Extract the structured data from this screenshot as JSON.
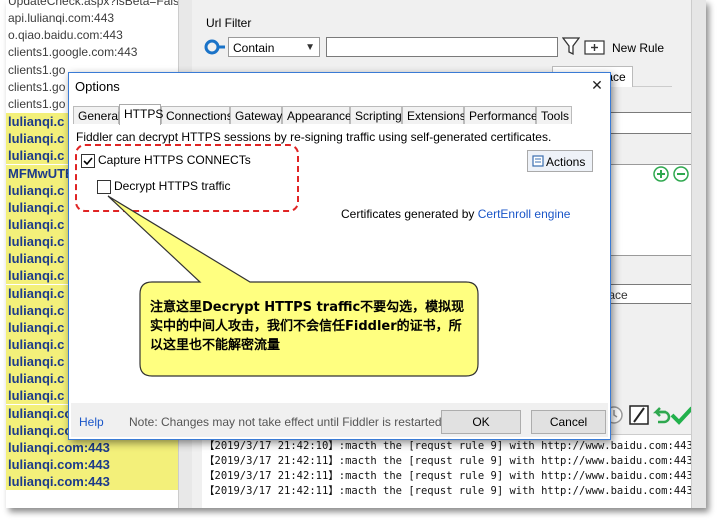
{
  "session_list": {
    "rows": [
      {
        "text": "UpdateCheck.aspx?isBeta=False",
        "highlight": false
      },
      {
        "text": "api.lulianqi.com:443",
        "highlight": false
      },
      {
        "text": "o.qiao.baidu.com:443",
        "highlight": false
      },
      {
        "text": "clients1.google.com:443",
        "highlight": false
      },
      {
        "text": "clients1.go",
        "highlight": false
      },
      {
        "text": "clients1.go",
        "highlight": false
      },
      {
        "text": "clients1.go",
        "highlight": false
      },
      {
        "text": "lulianqi.c",
        "highlight": true
      },
      {
        "text": "lulianqi.c",
        "highlight": true
      },
      {
        "text": "lulianqi.c",
        "highlight": true
      },
      {
        "text": "MFMwUTB",
        "highlight": true
      },
      {
        "text": "lulianqi.c",
        "highlight": true
      },
      {
        "text": "lulianqi.c",
        "highlight": true
      },
      {
        "text": "lulianqi.c",
        "highlight": true
      },
      {
        "text": "lulianqi.c",
        "highlight": true
      },
      {
        "text": "lulianqi.c",
        "highlight": true
      },
      {
        "text": "lulianqi.c",
        "highlight": true
      },
      {
        "text": "lulianqi.c",
        "highlight": true
      },
      {
        "text": "lulianqi.c",
        "highlight": true
      },
      {
        "text": "lulianqi.c",
        "highlight": true
      },
      {
        "text": "lulianqi.c",
        "highlight": true
      },
      {
        "text": "lulianqi.c",
        "highlight": true
      },
      {
        "text": "lulianqi.c",
        "highlight": true
      },
      {
        "text": "lulianqi.c",
        "highlight": true
      },
      {
        "text": "lulianqi.com:443",
        "highlight": true
      },
      {
        "text": "lulianqi.com:443",
        "highlight": true
      },
      {
        "text": "lulianqi.com:443",
        "highlight": true
      },
      {
        "text": "lulianqi.com:443",
        "highlight": true
      },
      {
        "text": "lulianqi.com:443",
        "highlight": true
      }
    ]
  },
  "filter": {
    "url_filter_label": "Url Filter",
    "match_mode": "Contain",
    "new_rule_label": "New Rule",
    "response_replace_tab": "nse Replace",
    "replace_field_text": "place"
  },
  "log": {
    "lines": [
      "【2019/3/17 21:42:10】:macth the [requst rule 9] with http://www.baidu.com:443",
      "【2019/3/17 21:42:11】:macth the [requst rule 9] with http://www.baidu.com:443",
      "【2019/3/17 21:42:11】:macth the [requst rule 9] with http://www.baidu.com:443",
      "【2019/3/17 21:42:11】:macth the [requst rule 9] with http://www.baidu.com:443"
    ]
  },
  "options_dialog": {
    "title": "Options",
    "close_glyph": "✕",
    "tabs": [
      {
        "label": "General",
        "active": false
      },
      {
        "label": "HTTPS",
        "active": true
      },
      {
        "label": "Connections",
        "active": false
      },
      {
        "label": "Gateway",
        "active": false
      },
      {
        "label": "Appearance",
        "active": false
      },
      {
        "label": "Scripting",
        "active": false
      },
      {
        "label": "Extensions",
        "active": false
      },
      {
        "label": "Performance",
        "active": false
      },
      {
        "label": "Tools",
        "active": false
      }
    ],
    "https_description": "Fiddler can decrypt HTTPS sessions by re-signing traffic using self-generated certificates.",
    "capture_label": "Capture HTTPS CONNECTs",
    "capture_checked": true,
    "decrypt_label": "Decrypt HTTPS traffic",
    "decrypt_checked": false,
    "actions_label": "Actions",
    "certs_prefix": "Certificates generated by ",
    "certs_link": "CertEnroll engine",
    "help_label": "Help",
    "restart_note": "Note: Changes may not take effect until Fiddler is restarted.",
    "ok_label": "OK",
    "cancel_label": "Cancel"
  },
  "callout": {
    "text": "注意这里Decrypt HTTPS traffic不要勾选，模拟现实中的中间人攻击，我们不会信任Fiddler的证书，所以这里也不能解密流量",
    "fill_color": "#ffff80"
  }
}
